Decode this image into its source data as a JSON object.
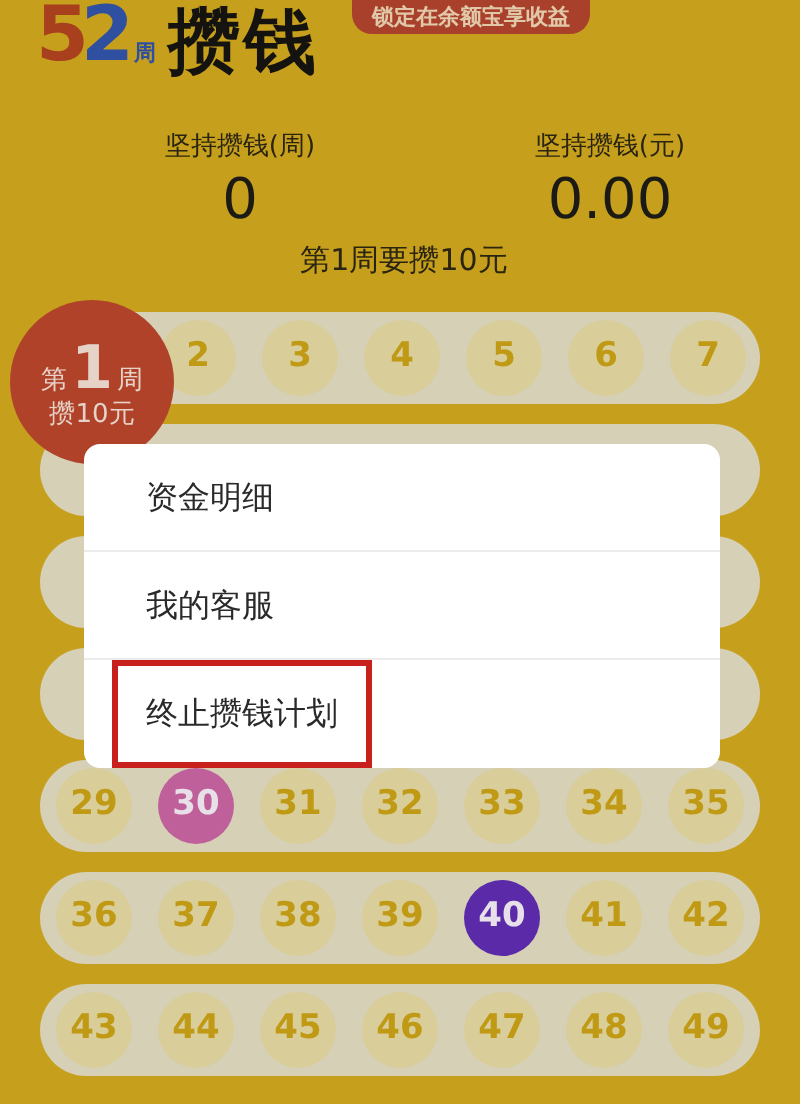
{
  "header": {
    "logo": {
      "digit_1": "5",
      "digit_2": "2",
      "unit": "周"
    },
    "title": "攒钱",
    "promo_bubble": "锁定在余额宝享收益"
  },
  "stats": [
    {
      "label": "坚持攒钱(周)",
      "value": "0"
    },
    {
      "label": "坚持攒钱(元)",
      "value": "0.00"
    }
  ],
  "current_goal": "第1周要攒10元",
  "week_badge": {
    "prefix": "第",
    "week": "1",
    "unit": "周",
    "amount": "攒10元"
  },
  "week_rows": [
    {
      "weeks": [
        {
          "label": "2"
        },
        {
          "label": "3"
        },
        {
          "label": "4"
        },
        {
          "label": "5"
        },
        {
          "label": "6"
        },
        {
          "label": "7"
        }
      ]
    },
    {
      "weeks": []
    },
    {
      "weeks": []
    },
    {
      "weeks": []
    },
    {
      "weeks": [
        {
          "label": "29"
        },
        {
          "label": "30",
          "color": "#c0609a"
        },
        {
          "label": "31"
        },
        {
          "label": "32"
        },
        {
          "label": "33"
        },
        {
          "label": "34"
        },
        {
          "label": "35"
        }
      ]
    },
    {
      "weeks": [
        {
          "label": "36"
        },
        {
          "label": "37"
        },
        {
          "label": "38"
        },
        {
          "label": "39"
        },
        {
          "label": "40",
          "color": "#5a2aa8"
        },
        {
          "label": "41"
        },
        {
          "label": "42"
        }
      ]
    },
    {
      "weeks": [
        {
          "label": "43"
        },
        {
          "label": "44"
        },
        {
          "label": "45"
        },
        {
          "label": "46"
        },
        {
          "label": "47"
        },
        {
          "label": "48"
        },
        {
          "label": "49"
        }
      ]
    }
  ],
  "menu": [
    {
      "label": "资金明细",
      "highlighted": false
    },
    {
      "label": "我的客服",
      "highlighted": false
    },
    {
      "label": "终止攒钱计划",
      "highlighted": true
    }
  ]
}
